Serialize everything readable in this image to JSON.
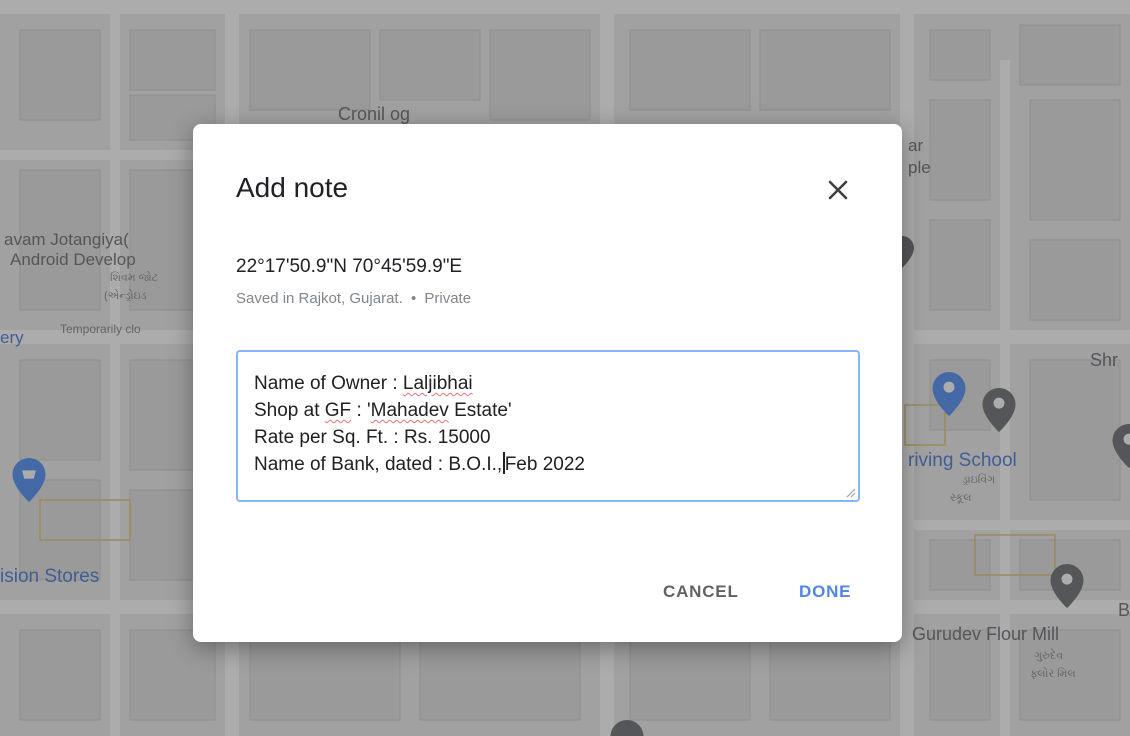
{
  "map": {
    "labels": {
      "place_top": "Cronil og",
      "person_name": "avam Jotangiya(",
      "person_role": "Android Develop",
      "person_sub1": "શિવમ જોટ",
      "person_sub2": "(એન્ડ્રોઇડ",
      "temp_closed": "Temporarily clo",
      "ery": "ery",
      "vision_stores": "ision Stores",
      "driving_school": "riving School",
      "driving_sub1": "ડ્રાઇવિંગ",
      "driving_sub2": "સ્કૂલ",
      "gurudev": "Gurudev Flour Mill",
      "gurudev_sub1": "ગુરુદેવ",
      "gurudev_sub2": "ફ્લોર મિલ",
      "shr": "Shr",
      "ar": "ar",
      "ple": "ple",
      "b_right": "B"
    },
    "colors": {
      "pin_blue": "#4285f4",
      "pin_gray": "#5f6368",
      "label_blue": "#3d6fd6"
    }
  },
  "dialog": {
    "title": "Add note",
    "close_icon": "close-icon",
    "coordinates": "22°17'50.9\"N 70°45'59.9\"E",
    "saved_in": "Saved in Rajkot, Gujarat.",
    "separator": "•",
    "visibility": "Private",
    "note": {
      "line1_prefix": "Name of Owner : ",
      "line1_word": "Laljibhai",
      "line2_prefix": "Shop at ",
      "line2_word1": "GF",
      "line2_mid": " : '",
      "line2_word2": "Mahadev",
      "line2_suffix": " Estate'",
      "line3": "Rate per Sq. Ft. : Rs. 15000",
      "line4_before_caret": "Name of Bank, dated :  B.O.I.,",
      "line4_after_caret": "Feb 2022"
    },
    "cancel_label": "CANCEL",
    "done_label": "DONE"
  }
}
